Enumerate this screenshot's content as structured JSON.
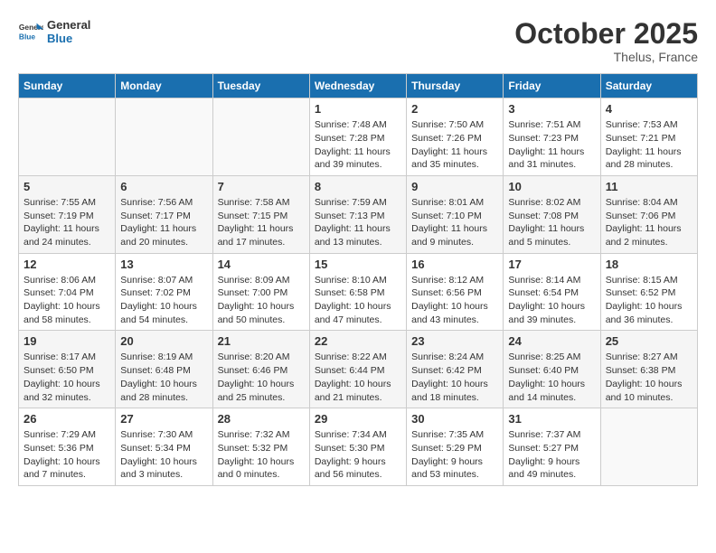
{
  "header": {
    "logo_general": "General",
    "logo_blue": "Blue",
    "month": "October 2025",
    "location": "Thelus, France"
  },
  "weekdays": [
    "Sunday",
    "Monday",
    "Tuesday",
    "Wednesday",
    "Thursday",
    "Friday",
    "Saturday"
  ],
  "weeks": [
    [
      {
        "day": "",
        "info": ""
      },
      {
        "day": "",
        "info": ""
      },
      {
        "day": "",
        "info": ""
      },
      {
        "day": "1",
        "info": "Sunrise: 7:48 AM\nSunset: 7:28 PM\nDaylight: 11 hours and 39 minutes."
      },
      {
        "day": "2",
        "info": "Sunrise: 7:50 AM\nSunset: 7:26 PM\nDaylight: 11 hours and 35 minutes."
      },
      {
        "day": "3",
        "info": "Sunrise: 7:51 AM\nSunset: 7:23 PM\nDaylight: 11 hours and 31 minutes."
      },
      {
        "day": "4",
        "info": "Sunrise: 7:53 AM\nSunset: 7:21 PM\nDaylight: 11 hours and 28 minutes."
      }
    ],
    [
      {
        "day": "5",
        "info": "Sunrise: 7:55 AM\nSunset: 7:19 PM\nDaylight: 11 hours and 24 minutes."
      },
      {
        "day": "6",
        "info": "Sunrise: 7:56 AM\nSunset: 7:17 PM\nDaylight: 11 hours and 20 minutes."
      },
      {
        "day": "7",
        "info": "Sunrise: 7:58 AM\nSunset: 7:15 PM\nDaylight: 11 hours and 17 minutes."
      },
      {
        "day": "8",
        "info": "Sunrise: 7:59 AM\nSunset: 7:13 PM\nDaylight: 11 hours and 13 minutes."
      },
      {
        "day": "9",
        "info": "Sunrise: 8:01 AM\nSunset: 7:10 PM\nDaylight: 11 hours and 9 minutes."
      },
      {
        "day": "10",
        "info": "Sunrise: 8:02 AM\nSunset: 7:08 PM\nDaylight: 11 hours and 5 minutes."
      },
      {
        "day": "11",
        "info": "Sunrise: 8:04 AM\nSunset: 7:06 PM\nDaylight: 11 hours and 2 minutes."
      }
    ],
    [
      {
        "day": "12",
        "info": "Sunrise: 8:06 AM\nSunset: 7:04 PM\nDaylight: 10 hours and 58 minutes."
      },
      {
        "day": "13",
        "info": "Sunrise: 8:07 AM\nSunset: 7:02 PM\nDaylight: 10 hours and 54 minutes."
      },
      {
        "day": "14",
        "info": "Sunrise: 8:09 AM\nSunset: 7:00 PM\nDaylight: 10 hours and 50 minutes."
      },
      {
        "day": "15",
        "info": "Sunrise: 8:10 AM\nSunset: 6:58 PM\nDaylight: 10 hours and 47 minutes."
      },
      {
        "day": "16",
        "info": "Sunrise: 8:12 AM\nSunset: 6:56 PM\nDaylight: 10 hours and 43 minutes."
      },
      {
        "day": "17",
        "info": "Sunrise: 8:14 AM\nSunset: 6:54 PM\nDaylight: 10 hours and 39 minutes."
      },
      {
        "day": "18",
        "info": "Sunrise: 8:15 AM\nSunset: 6:52 PM\nDaylight: 10 hours and 36 minutes."
      }
    ],
    [
      {
        "day": "19",
        "info": "Sunrise: 8:17 AM\nSunset: 6:50 PM\nDaylight: 10 hours and 32 minutes."
      },
      {
        "day": "20",
        "info": "Sunrise: 8:19 AM\nSunset: 6:48 PM\nDaylight: 10 hours and 28 minutes."
      },
      {
        "day": "21",
        "info": "Sunrise: 8:20 AM\nSunset: 6:46 PM\nDaylight: 10 hours and 25 minutes."
      },
      {
        "day": "22",
        "info": "Sunrise: 8:22 AM\nSunset: 6:44 PM\nDaylight: 10 hours and 21 minutes."
      },
      {
        "day": "23",
        "info": "Sunrise: 8:24 AM\nSunset: 6:42 PM\nDaylight: 10 hours and 18 minutes."
      },
      {
        "day": "24",
        "info": "Sunrise: 8:25 AM\nSunset: 6:40 PM\nDaylight: 10 hours and 14 minutes."
      },
      {
        "day": "25",
        "info": "Sunrise: 8:27 AM\nSunset: 6:38 PM\nDaylight: 10 hours and 10 minutes."
      }
    ],
    [
      {
        "day": "26",
        "info": "Sunrise: 7:29 AM\nSunset: 5:36 PM\nDaylight: 10 hours and 7 minutes."
      },
      {
        "day": "27",
        "info": "Sunrise: 7:30 AM\nSunset: 5:34 PM\nDaylight: 10 hours and 3 minutes."
      },
      {
        "day": "28",
        "info": "Sunrise: 7:32 AM\nSunset: 5:32 PM\nDaylight: 10 hours and 0 minutes."
      },
      {
        "day": "29",
        "info": "Sunrise: 7:34 AM\nSunset: 5:30 PM\nDaylight: 9 hours and 56 minutes."
      },
      {
        "day": "30",
        "info": "Sunrise: 7:35 AM\nSunset: 5:29 PM\nDaylight: 9 hours and 53 minutes."
      },
      {
        "day": "31",
        "info": "Sunrise: 7:37 AM\nSunset: 5:27 PM\nDaylight: 9 hours and 49 minutes."
      },
      {
        "day": "",
        "info": ""
      }
    ]
  ]
}
